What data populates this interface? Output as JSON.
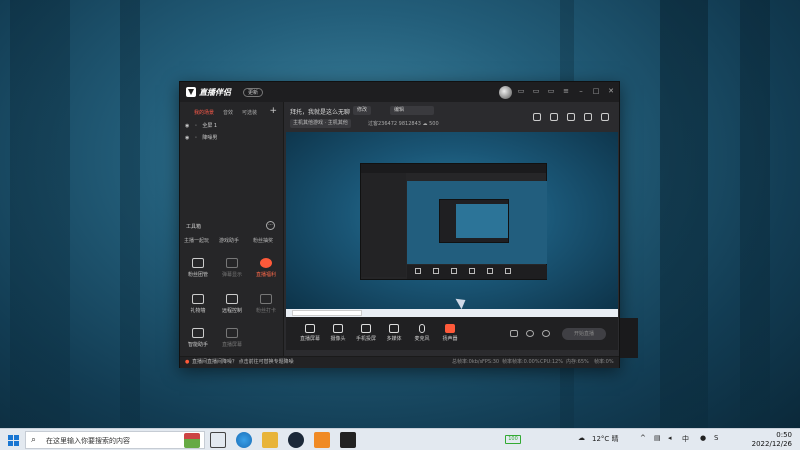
{
  "app": {
    "name": "直播伴侣",
    "version_badge": "更新",
    "left_tabs": [
      "我的场景",
      "音效",
      "可选装"
    ],
    "scenes": [
      "全屏 1",
      "降噪男"
    ],
    "toolbox": {
      "title": "工具箱",
      "row1": [
        "主播一起玩",
        "游戏助手",
        "粉丝抽奖"
      ],
      "tools": [
        {
          "label": "粉丝团管",
          "state": "normal"
        },
        {
          "label": "弹幕显示",
          "state": "dim"
        },
        {
          "label": "直播福利",
          "state": "hot"
        },
        {
          "label": "礼物墙",
          "state": "normal"
        },
        {
          "label": "远程控制",
          "state": "normal"
        },
        {
          "label": "粉丝打卡",
          "state": "dim"
        },
        {
          "label": "智能助手",
          "state": "normal"
        },
        {
          "label": "直播屏幕",
          "state": "dim"
        }
      ]
    },
    "header": {
      "title": "拜托，我就是这么无聊",
      "chip1": "修改",
      "chip2": "编辑",
      "category": "主机其他游戏 · 主机其他",
      "stats": "过客236472  9812843  ☁ 500"
    },
    "dock": [
      "直播屏幕",
      "摄像头",
      "手机投屏",
      "多媒体",
      "麦克风",
      "扬声器"
    ],
    "go_live": "开始直播",
    "status": {
      "message": "直播间直播间降噪？ 点击前往可替换专题降噪",
      "metrics": [
        "总帧率:0kb/s",
        "FPS:30",
        "帧率帧率:0.00%",
        "CPU:12%",
        "内存:65%",
        "帧率:0%"
      ]
    },
    "colors": {
      "accent": "#ff5a3a",
      "window_bg": "#2b2b2e"
    }
  },
  "taskbar": {
    "search_placeholder": "在这里输入你要搜索的内容",
    "battery": "100",
    "weather": "12°C 晴",
    "time": "0:50",
    "date": "2022/12/26"
  }
}
